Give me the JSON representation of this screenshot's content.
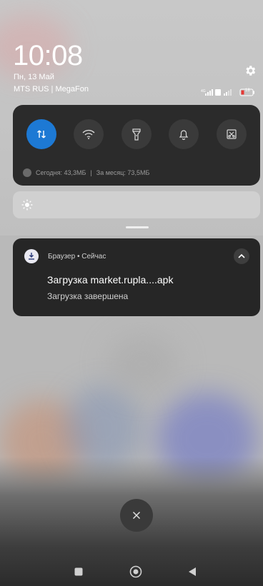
{
  "status": {
    "time": "10:08",
    "date": "Пн, 13 Май",
    "carrier": "MTS RUS | MegaFon",
    "battery_level": "18"
  },
  "quick_settings": {
    "tiles": [
      {
        "name": "mobile-data",
        "icon": "data-arrows-icon",
        "active": true
      },
      {
        "name": "wifi",
        "icon": "wifi-icon",
        "active": false
      },
      {
        "name": "flashlight",
        "icon": "flashlight-icon",
        "active": false
      },
      {
        "name": "sound",
        "icon": "bell-icon",
        "active": false
      },
      {
        "name": "screenshot",
        "icon": "screenshot-icon",
        "active": false
      }
    ],
    "usage_today": "Сегодня: 43,3МБ",
    "separator": "|",
    "usage_month": "За месяц: 73,5МБ"
  },
  "brightness": {
    "icon": "sun-icon"
  },
  "notification": {
    "app_line": "Браузер • Сейчас",
    "title": "Загрузка market.rupla....apk",
    "subtitle": "Загрузка завершена",
    "icon": "download-icon"
  },
  "controls": {
    "close_icon": "close-icon"
  },
  "navbar": {
    "items": [
      "recents-icon",
      "home-icon",
      "back-icon"
    ]
  },
  "colors": {
    "accent": "#1d79d4",
    "panel": "#2b2b2b",
    "notification_bg": "#262626"
  }
}
